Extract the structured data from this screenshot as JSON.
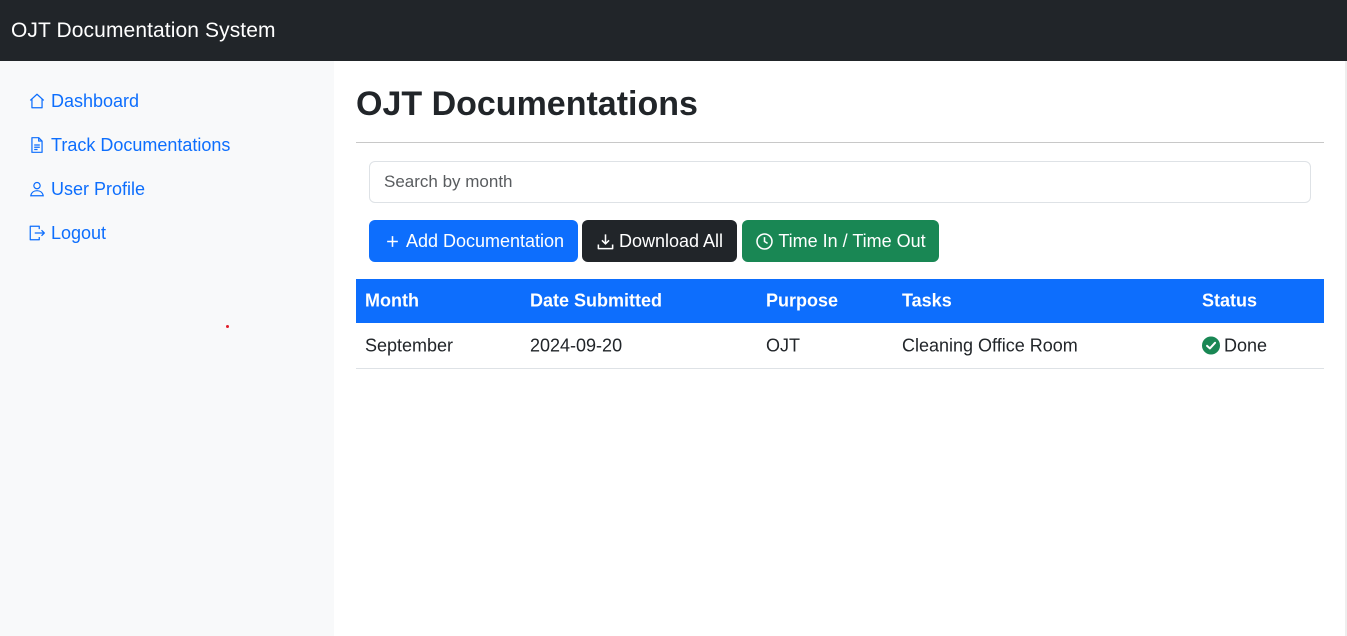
{
  "app": {
    "title": "OJT Documentation System"
  },
  "sidebar": {
    "items": [
      {
        "label": "Dashboard",
        "icon": "house-icon"
      },
      {
        "label": "Track Documentations",
        "icon": "document-icon"
      },
      {
        "label": "User Profile",
        "icon": "person-icon"
      },
      {
        "label": "Logout",
        "icon": "logout-icon"
      }
    ]
  },
  "main": {
    "title": "OJT Documentations",
    "search": {
      "placeholder": "Search by month",
      "value": ""
    },
    "buttons": {
      "add": "Add Documentation",
      "download": "Download All",
      "time": "Time In / Time Out"
    },
    "table": {
      "headers": [
        "Month",
        "Date Submitted",
        "Purpose",
        "Tasks",
        "Status"
      ],
      "rows": [
        {
          "month": "September",
          "date": "2024-09-20",
          "purpose": "OJT",
          "tasks": "Cleaning Office Room",
          "status": "Done"
        }
      ]
    }
  },
  "colors": {
    "navbar": "#212529",
    "sidebar_bg": "#f8f9fa",
    "primary": "#0d6efd",
    "dark": "#212529",
    "success": "#198754"
  }
}
